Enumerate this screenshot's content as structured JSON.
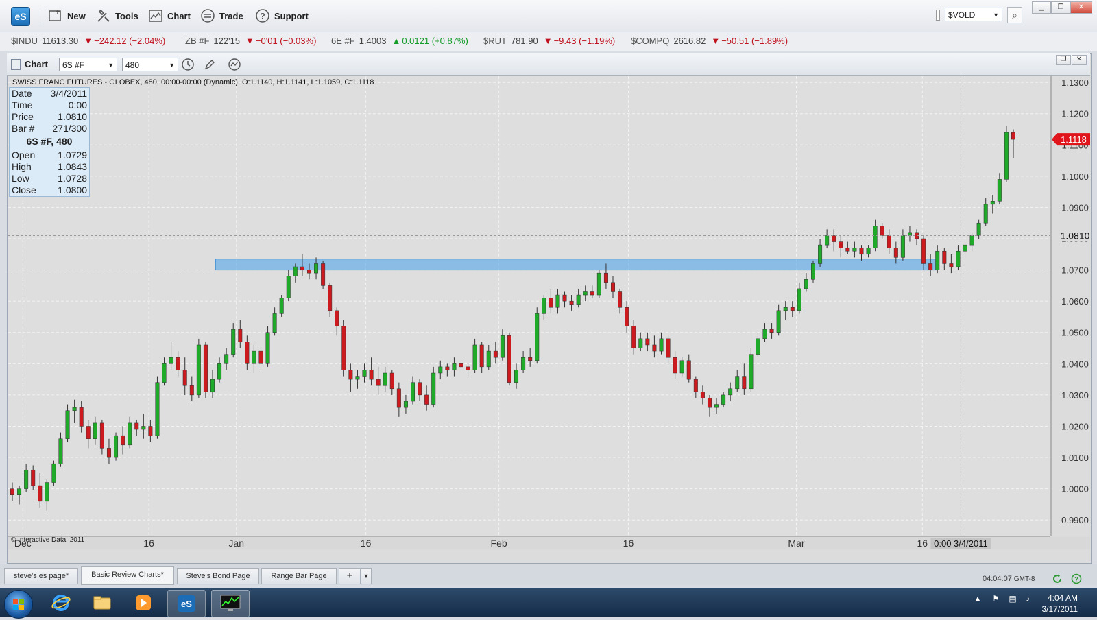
{
  "app": {
    "logo_text": "eS"
  },
  "menu": [
    {
      "label": "New",
      "icon": "new-chart-icon"
    },
    {
      "label": "Tools",
      "icon": "tools-icon"
    },
    {
      "label": "Chart",
      "icon": "chart-icon"
    },
    {
      "label": "Trade",
      "icon": "trade-icon"
    },
    {
      "label": "Support",
      "icon": "help-icon"
    }
  ],
  "symbol_lookup": {
    "value": "$VOLD"
  },
  "ticker": [
    {
      "symbol": "$INDU",
      "last": "11613.30",
      "change": "−242.12 (−2.04%)",
      "dir": "down"
    },
    {
      "symbol": "ZB #F",
      "last": "122'15",
      "change": "−0'01 (−0.03%)",
      "dir": "down"
    },
    {
      "symbol": "6E #F",
      "last": "1.4003",
      "change": "0.0121 (+0.87%)",
      "dir": "up"
    },
    {
      "symbol": "$RUT",
      "last": "781.90",
      "change": "−9.43 (−1.19%)",
      "dir": "down"
    },
    {
      "symbol": "$COMPQ",
      "last": "2616.82",
      "change": "−50.51 (−1.89%)",
      "dir": "down"
    }
  ],
  "chart_toolbar": {
    "label": "Chart",
    "symbol": "6S #F",
    "interval": "480"
  },
  "chart_header": "SWISS FRANC FUTURES - GLOBEX, 480, 00:00-00:00 (Dynamic), O:1.1140, H:1.1141, L:1.1059, C:1.1118",
  "data_box": {
    "date_label": "Date",
    "date": "3/4/2011",
    "time_label": "Time",
    "time": "0:00",
    "price_label": "Price",
    "price": "1.0810",
    "bar_label": "Bar #",
    "bar": "271/300",
    "title": "6S #F, 480",
    "open_label": "Open",
    "open": "1.0729",
    "high_label": "High",
    "high": "1.0843",
    "low_label": "Low",
    "low": "1.0728",
    "close_label": "Close",
    "close": "1.0800"
  },
  "copyright": "© Interactive Data, 2011",
  "chart_data": {
    "type": "candlestick",
    "ylim": [
      0.985,
      1.132
    ],
    "yticks": [
      0.99,
      1.0,
      1.01,
      1.02,
      1.03,
      1.04,
      1.05,
      1.06,
      1.07,
      1.08,
      1.09,
      1.1,
      1.11,
      1.12,
      1.13
    ],
    "ytick_labels": [
      "0.9900",
      "1.0000",
      "1.0100",
      "1.0200",
      "1.0300",
      "1.0400",
      "1.0500",
      "1.0600",
      "1.0700",
      "1.0800",
      "1.0900",
      "1.1000",
      "1.1100",
      "1.1200",
      "1.1300"
    ],
    "xtick_labels": [
      "Dec",
      "16",
      "Jan",
      "16",
      "Feb",
      "16",
      "Mar",
      "16"
    ],
    "xtick_bar_index": [
      3,
      39,
      64,
      101,
      139,
      176,
      224,
      260
    ],
    "bar_count": 300,
    "visible_first_bar": 0,
    "visible_last_bar": 286,
    "current_price": "1.1118",
    "crosshair_price": "1.0810",
    "crosshair_time_label": "0:00 3/4/2011",
    "crosshair_bar": 271,
    "zone": {
      "low": 1.07,
      "high": 1.0735,
      "bar_start": 58,
      "bar_end": 264
    },
    "candles": [
      [
        1.0,
        1.002,
        0.996,
        0.998
      ],
      [
        0.998,
        1.001,
        0.995,
        1.0
      ],
      [
        1.0,
        1.008,
        0.999,
        1.006
      ],
      [
        1.006,
        1.0075,
        0.9995,
        1.001
      ],
      [
        1.001,
        1.005,
        0.994,
        0.996
      ],
      [
        0.996,
        1.003,
        0.993,
        1.002
      ],
      [
        1.002,
        1.009,
        1.001,
        1.008
      ],
      [
        1.008,
        1.018,
        1.007,
        1.016
      ],
      [
        1.016,
        1.027,
        1.015,
        1.025
      ],
      [
        1.025,
        1.0285,
        1.021,
        1.026
      ],
      [
        1.026,
        1.028,
        1.018,
        1.02
      ],
      [
        1.02,
        1.022,
        1.013,
        1.016
      ],
      [
        1.016,
        1.023,
        1.014,
        1.021
      ],
      [
        1.021,
        1.022,
        1.011,
        1.013
      ],
      [
        1.013,
        1.016,
        1.008,
        1.01
      ],
      [
        1.01,
        1.018,
        1.009,
        1.017
      ],
      [
        1.017,
        1.02,
        1.011,
        1.014
      ],
      [
        1.014,
        1.023,
        1.013,
        1.021
      ],
      [
        1.021,
        1.022,
        1.017,
        1.019
      ],
      [
        1.019,
        1.024,
        1.016,
        1.02
      ],
      [
        1.02,
        1.022,
        1.015,
        1.017
      ],
      [
        1.017,
        1.036,
        1.016,
        1.034
      ],
      [
        1.034,
        1.042,
        1.033,
        1.04
      ],
      [
        1.04,
        1.047,
        1.038,
        1.042
      ],
      [
        1.042,
        1.044,
        1.036,
        1.038
      ],
      [
        1.038,
        1.042,
        1.03,
        1.033
      ],
      [
        1.033,
        1.036,
        1.028,
        1.03
      ],
      [
        1.03,
        1.048,
        1.029,
        1.046
      ],
      [
        1.046,
        1.047,
        1.029,
        1.031
      ],
      [
        1.031,
        1.038,
        1.029,
        1.035
      ],
      [
        1.035,
        1.042,
        1.034,
        1.04
      ],
      [
        1.04,
        1.045,
        1.038,
        1.043
      ],
      [
        1.043,
        1.053,
        1.042,
        1.051
      ],
      [
        1.051,
        1.054,
        1.045,
        1.047
      ],
      [
        1.047,
        1.049,
        1.038,
        1.04
      ],
      [
        1.04,
        1.046,
        1.037,
        1.044
      ],
      [
        1.044,
        1.045,
        1.038,
        1.04
      ],
      [
        1.04,
        1.052,
        1.039,
        1.05
      ],
      [
        1.05,
        1.058,
        1.049,
        1.056
      ],
      [
        1.056,
        1.062,
        1.055,
        1.061
      ],
      [
        1.061,
        1.07,
        1.06,
        1.068
      ],
      [
        1.068,
        1.072,
        1.066,
        1.071
      ],
      [
        1.071,
        1.075,
        1.068,
        1.07
      ],
      [
        1.07,
        1.072,
        1.067,
        1.069
      ],
      [
        1.069,
        1.074,
        1.067,
        1.072
      ],
      [
        1.072,
        1.073,
        1.064,
        1.065
      ],
      [
        1.065,
        1.066,
        1.055,
        1.057
      ],
      [
        1.057,
        1.058,
        1.049,
        1.052
      ],
      [
        1.052,
        1.054,
        1.036,
        1.038
      ],
      [
        1.038,
        1.04,
        1.031,
        1.035
      ],
      [
        1.035,
        1.038,
        1.032,
        1.036
      ],
      [
        1.036,
        1.04,
        1.034,
        1.038
      ],
      [
        1.038,
        1.042,
        1.033,
        1.035
      ],
      [
        1.035,
        1.039,
        1.03,
        1.033
      ],
      [
        1.033,
        1.039,
        1.031,
        1.037
      ],
      [
        1.037,
        1.038,
        1.03,
        1.032
      ],
      [
        1.032,
        1.034,
        1.023,
        1.026
      ],
      [
        1.026,
        1.03,
        1.024,
        1.028
      ],
      [
        1.028,
        1.036,
        1.027,
        1.034
      ],
      [
        1.034,
        1.035,
        1.028,
        1.03
      ],
      [
        1.03,
        1.033,
        1.025,
        1.027
      ],
      [
        1.027,
        1.039,
        1.026,
        1.037
      ],
      [
        1.037,
        1.041,
        1.035,
        1.039
      ],
      [
        1.039,
        1.04,
        1.036,
        1.038
      ],
      [
        1.038,
        1.042,
        1.036,
        1.04
      ],
      [
        1.04,
        1.041,
        1.037,
        1.039
      ],
      [
        1.039,
        1.04,
        1.036,
        1.038
      ],
      [
        1.038,
        1.048,
        1.037,
        1.046
      ],
      [
        1.046,
        1.047,
        1.037,
        1.039
      ],
      [
        1.039,
        1.046,
        1.038,
        1.044
      ],
      [
        1.044,
        1.047,
        1.04,
        1.042
      ],
      [
        1.042,
        1.051,
        1.041,
        1.049
      ],
      [
        1.049,
        1.05,
        1.033,
        1.034
      ],
      [
        1.034,
        1.04,
        1.032,
        1.038
      ],
      [
        1.038,
        1.044,
        1.037,
        1.042
      ],
      [
        1.042,
        1.045,
        1.039,
        1.041
      ],
      [
        1.041,
        1.058,
        1.04,
        1.056
      ],
      [
        1.056,
        1.062,
        1.054,
        1.061
      ],
      [
        1.061,
        1.064,
        1.056,
        1.058
      ],
      [
        1.058,
        1.064,
        1.056,
        1.062
      ],
      [
        1.062,
        1.063,
        1.058,
        1.06
      ],
      [
        1.06,
        1.062,
        1.057,
        1.059
      ],
      [
        1.059,
        1.064,
        1.058,
        1.062
      ],
      [
        1.062,
        1.065,
        1.06,
        1.063
      ],
      [
        1.063,
        1.065,
        1.061,
        1.062
      ],
      [
        1.062,
        1.07,
        1.061,
        1.069
      ],
      [
        1.069,
        1.072,
        1.064,
        1.066
      ],
      [
        1.066,
        1.068,
        1.061,
        1.063
      ],
      [
        1.063,
        1.064,
        1.056,
        1.058
      ],
      [
        1.058,
        1.06,
        1.05,
        1.052
      ],
      [
        1.052,
        1.054,
        1.043,
        1.045
      ],
      [
        1.045,
        1.05,
        1.044,
        1.048
      ],
      [
        1.048,
        1.05,
        1.044,
        1.046
      ],
      [
        1.046,
        1.049,
        1.042,
        1.044
      ],
      [
        1.044,
        1.05,
        1.043,
        1.048
      ],
      [
        1.048,
        1.049,
        1.04,
        1.042
      ],
      [
        1.042,
        1.044,
        1.035,
        1.037
      ],
      [
        1.037,
        1.042,
        1.036,
        1.041
      ],
      [
        1.041,
        1.043,
        1.034,
        1.035
      ],
      [
        1.035,
        1.036,
        1.029,
        1.031
      ],
      [
        1.031,
        1.033,
        1.027,
        1.029
      ],
      [
        1.029,
        1.03,
        1.023,
        1.026
      ],
      [
        1.026,
        1.029,
        1.024,
        1.027
      ],
      [
        1.027,
        1.031,
        1.026,
        1.03
      ],
      [
        1.03,
        1.034,
        1.028,
        1.032
      ],
      [
        1.032,
        1.038,
        1.031,
        1.036
      ],
      [
        1.036,
        1.04,
        1.03,
        1.032
      ],
      [
        1.032,
        1.045,
        1.031,
        1.043
      ],
      [
        1.043,
        1.05,
        1.042,
        1.048
      ],
      [
        1.048,
        1.053,
        1.047,
        1.051
      ],
      [
        1.051,
        1.053,
        1.048,
        1.05
      ],
      [
        1.05,
        1.059,
        1.049,
        1.057
      ],
      [
        1.057,
        1.06,
        1.054,
        1.058
      ],
      [
        1.058,
        1.06,
        1.055,
        1.057
      ],
      [
        1.057,
        1.066,
        1.056,
        1.064
      ],
      [
        1.064,
        1.069,
        1.063,
        1.067
      ],
      [
        1.067,
        1.073,
        1.066,
        1.072
      ],
      [
        1.072,
        1.08,
        1.071,
        1.078
      ],
      [
        1.078,
        1.083,
        1.077,
        1.081
      ],
      [
        1.081,
        1.083,
        1.076,
        1.079
      ],
      [
        1.079,
        1.081,
        1.074,
        1.077
      ],
      [
        1.077,
        1.079,
        1.075,
        1.076
      ],
      [
        1.076,
        1.079,
        1.074,
        1.077
      ],
      [
        1.077,
        1.078,
        1.073,
        1.075
      ],
      [
        1.075,
        1.078,
        1.074,
        1.077
      ],
      [
        1.077,
        1.086,
        1.076,
        1.084
      ],
      [
        1.084,
        1.085,
        1.08,
        1.081
      ],
      [
        1.081,
        1.083,
        1.075,
        1.077
      ],
      [
        1.077,
        1.079,
        1.072,
        1.074
      ],
      [
        1.074,
        1.083,
        1.073,
        1.081
      ],
      [
        1.081,
        1.084,
        1.079,
        1.082
      ],
      [
        1.082,
        1.083,
        1.078,
        1.08
      ],
      [
        1.08,
        1.081,
        1.07,
        1.072
      ],
      [
        1.072,
        1.075,
        1.068,
        1.07
      ],
      [
        1.07,
        1.078,
        1.069,
        1.076
      ],
      [
        1.076,
        1.077,
        1.07,
        1.072
      ],
      [
        1.072,
        1.075,
        1.069,
        1.071
      ],
      [
        1.071,
        1.078,
        1.07,
        1.076
      ],
      [
        1.076,
        1.079,
        1.074,
        1.078
      ],
      [
        1.078,
        1.082,
        1.076,
        1.081
      ],
      [
        1.081,
        1.086,
        1.08,
        1.085
      ],
      [
        1.085,
        1.093,
        1.084,
        1.091
      ],
      [
        1.091,
        1.094,
        1.088,
        1.092
      ],
      [
        1.092,
        1.101,
        1.091,
        1.099
      ],
      [
        1.099,
        1.116,
        1.098,
        1.114
      ],
      [
        1.114,
        1.115,
        1.1059,
        1.1118
      ]
    ]
  },
  "tabs": [
    {
      "label": "steve's es page*",
      "active": false
    },
    {
      "label": "Basic Review Charts*",
      "active": true
    },
    {
      "label": "Steve's Bond Page",
      "active": false
    },
    {
      "label": "Range Bar Page",
      "active": false
    }
  ],
  "status": {
    "time": "04:04:07",
    "tz": "GMT-8"
  },
  "system_clock": {
    "time": "4:04 AM",
    "date": "3/17/2011"
  }
}
